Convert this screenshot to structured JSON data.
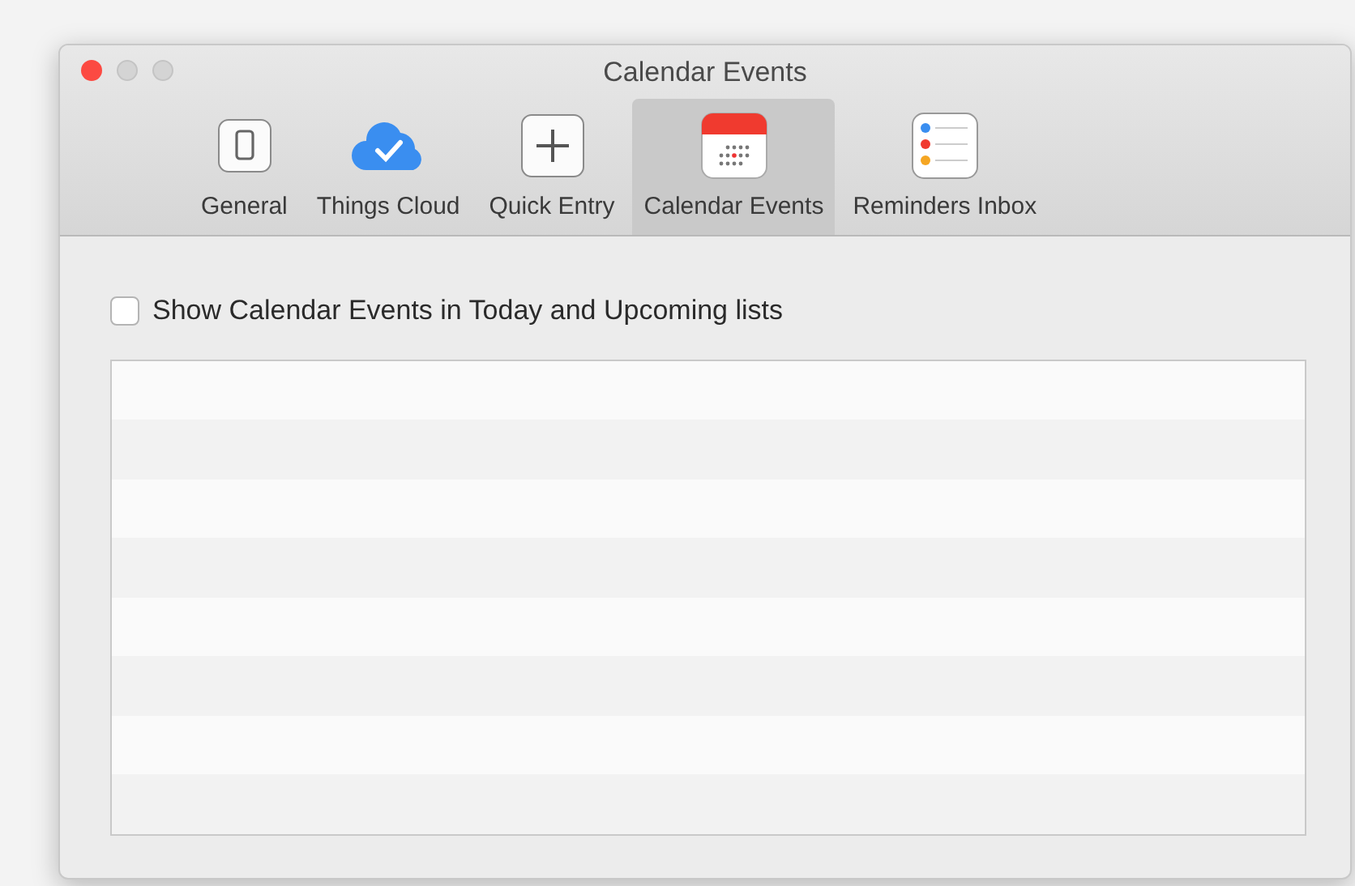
{
  "window": {
    "title": "Calendar Events"
  },
  "tabs": [
    {
      "label": "General",
      "kind": "phone",
      "selected": false
    },
    {
      "label": "Things Cloud",
      "kind": "cloud",
      "selected": false
    },
    {
      "label": "Quick Entry",
      "kind": "plus",
      "selected": false
    },
    {
      "label": "Calendar Events",
      "kind": "calendar",
      "selected": true
    },
    {
      "label": "Reminders Inbox",
      "kind": "reminders",
      "selected": false
    }
  ],
  "option": {
    "label": "Show Calendar Events in Today and Upcoming lists",
    "checked": false
  }
}
